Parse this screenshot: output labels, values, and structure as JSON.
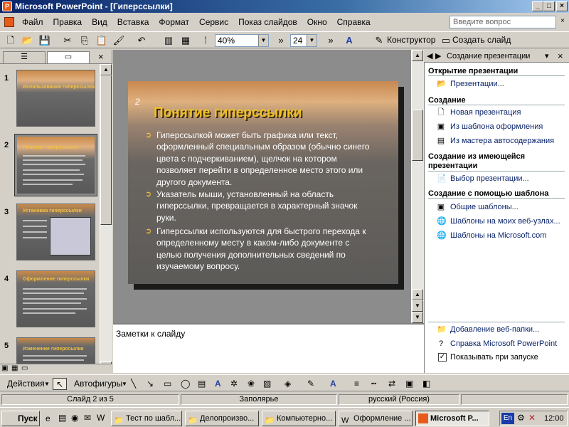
{
  "window": {
    "title": "Microsoft PowerPoint - [Гиперссылки]",
    "controls": [
      "_",
      "□",
      "×"
    ]
  },
  "menubar": {
    "items": [
      "Файл",
      "Правка",
      "Вид",
      "Вставка",
      "Формат",
      "Сервис",
      "Показ слайдов",
      "Окно",
      "Справка"
    ],
    "help_placeholder": "Введите вопрос"
  },
  "toolbar": {
    "zoom": "40%",
    "font_size": "24",
    "designer_label": "Конструктор",
    "new_slide_label": "Создать слайд"
  },
  "left_panel": {
    "slides": [
      {
        "number": "1",
        "title": "Использование гиперссылок"
      },
      {
        "number": "2",
        "title": "Понятие гиперссылки"
      },
      {
        "number": "3",
        "title": "Установка гиперссылки"
      },
      {
        "number": "4",
        "title": "Оформление гиперссылки"
      },
      {
        "number": "5",
        "title": "Изменение гиперссылки"
      }
    ]
  },
  "slide": {
    "number": "2",
    "title": "Понятие гиперссылки",
    "bullets": [
      "Гиперссылкой может быть графика или текст, оформленный специальным образом (обычно синего цвета с подчеркиванием), щелчок на котором позволяет перейти в определенное место этого или другого документа.",
      "Указатель мыши, установленный на область гиперссылки, превращается в характерный значок руки.",
      "Гиперссылки используются для быстрого перехода к определенному месту в каком-либо документе с целью получения дополнительных сведений по изучаемому вопросу."
    ]
  },
  "notes": {
    "text": "Заметки к слайду"
  },
  "task_pane": {
    "title": "Создание презентации",
    "sections": [
      {
        "heading": "Открытие презентации",
        "links": [
          "Презентации..."
        ]
      },
      {
        "heading": "Создание",
        "links": [
          "Новая презентация",
          "Из шаблона оформления",
          "Из мастера автосодержания"
        ]
      },
      {
        "heading": "Создание из имеющейся презентации",
        "links": [
          "Выбор презентации..."
        ]
      },
      {
        "heading": "Создание с помощью шаблона",
        "links": [
          "Общие шаблоны...",
          "Шаблоны на моих веб-узлах...",
          "Шаблоны на Microsoft.com"
        ]
      }
    ],
    "footer": {
      "add_web_folder": "Добавление веб-папки...",
      "help": "Справка Microsoft PowerPoint",
      "show_on_start": "Показывать при запуске"
    }
  },
  "drawbar": {
    "actions": "Действия",
    "autoshapes": "Автофигуры"
  },
  "statusbar": {
    "slide": "Слайд 2 из 5",
    "design": "Заполярье",
    "language": "русский (Россия)"
  },
  "taskbar": {
    "start": "Пуск",
    "tasks": [
      "Тест по шабл...",
      "Делопроизво...",
      "Компьютерно...",
      "Оформление ...",
      "Microsoft P..."
    ],
    "lang": "En",
    "clock": "12:00"
  },
  "colors": {
    "title_bar": "#0a246a",
    "slide_title": "#f0c020",
    "link": "#0a246a"
  }
}
